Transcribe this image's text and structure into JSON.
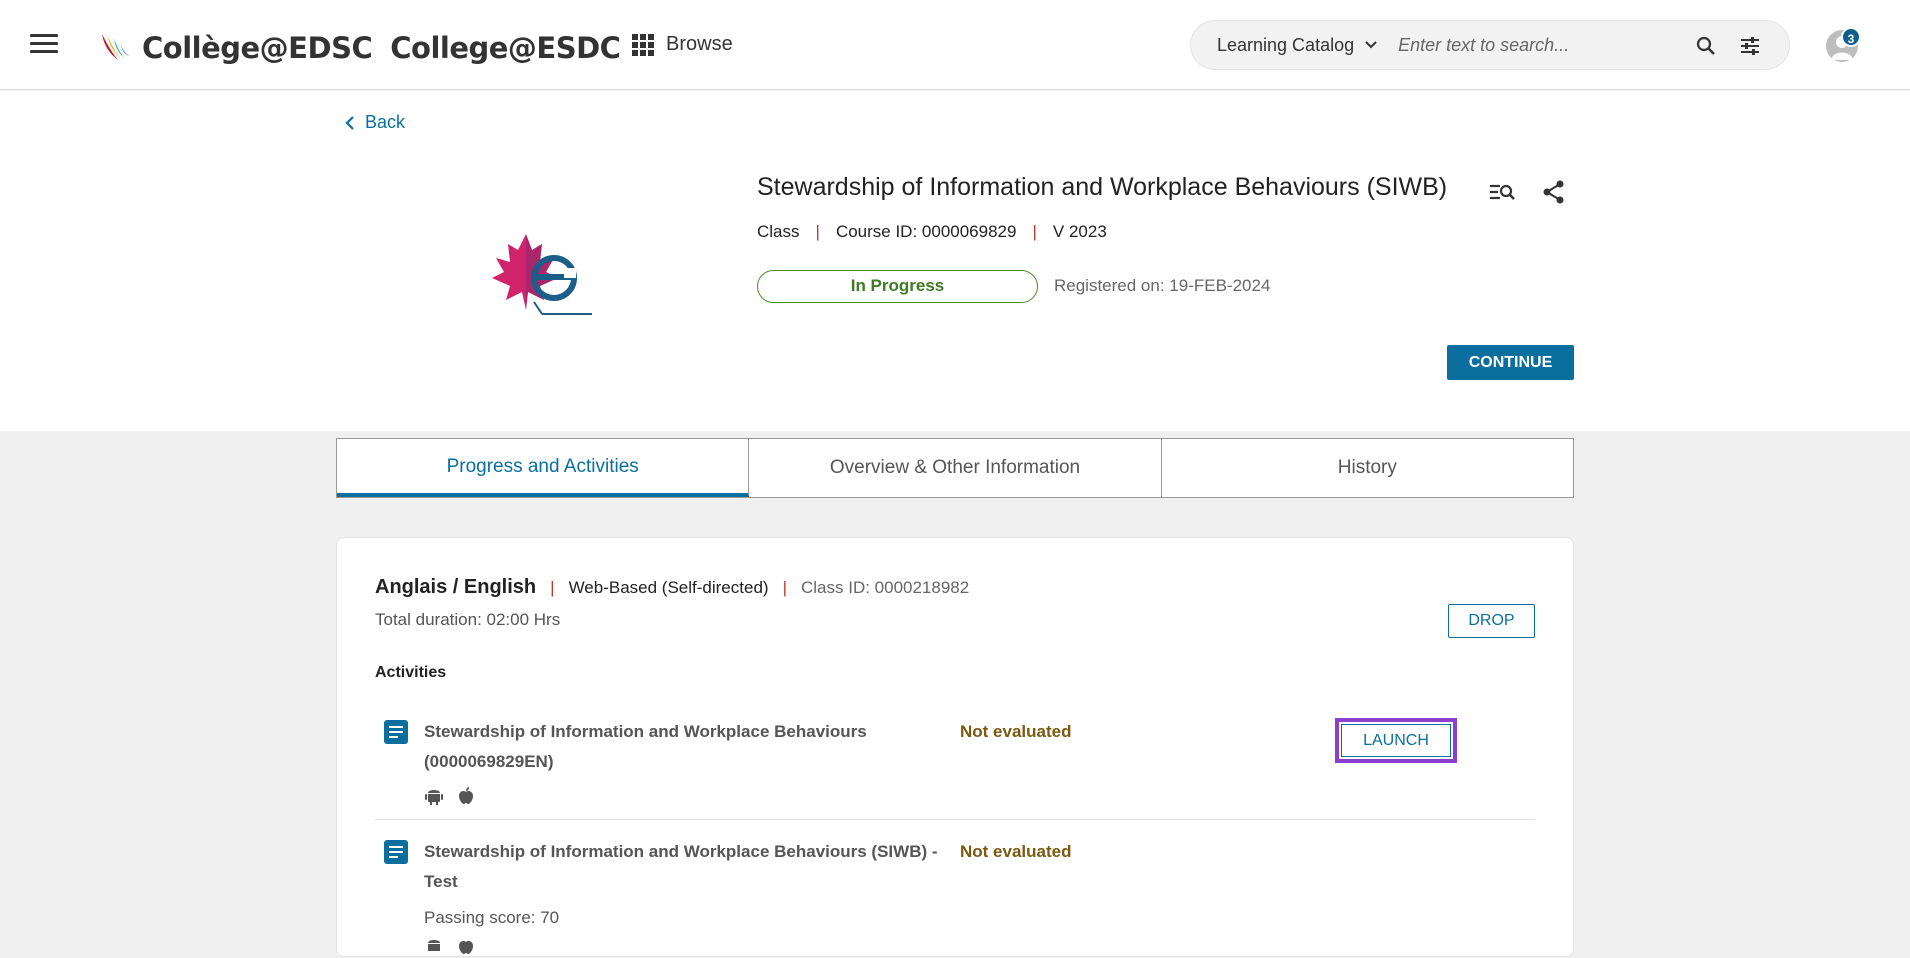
{
  "header": {
    "brand_fr": "Collège@EDSC",
    "brand_en": "College@ESDC",
    "browse_label": "Browse",
    "search": {
      "catalog_label": "Learning Catalog",
      "placeholder": "Enter text to search..."
    },
    "notification_count": "3"
  },
  "course": {
    "back_label": "Back",
    "title": "Stewardship of Information and Workplace Behaviours (SIWB)",
    "type": "Class",
    "course_id": "Course ID: 0000069829",
    "version": "V 2023",
    "status": "In Progress",
    "registered": "Registered on: 19-FEB-2024",
    "continue_label": "CONTINUE"
  },
  "tabs": [
    {
      "label": "Progress and Activities",
      "active": true
    },
    {
      "label": "Overview & Other Information",
      "active": false
    },
    {
      "label": "History",
      "active": false
    }
  ],
  "class_info": {
    "language": "Anglais / English",
    "delivery": "Web-Based (Self-directed)",
    "class_id": "Class ID: 0000218982",
    "duration": "Total duration: 02:00 Hrs",
    "drop_label": "DROP",
    "activities_label": "Activities"
  },
  "activities": [
    {
      "title": "Stewardship of Information and Workplace Behaviours (0000069829EN)",
      "status": "Not evaluated",
      "launch_label": "LAUNCH",
      "platforms": [
        "android-icon",
        "apple-icon"
      ]
    },
    {
      "title": "Stewardship of Information and Workplace Behaviours (SIWB) - Test",
      "status": "Not evaluated",
      "passing_score": "Passing score: 70",
      "platforms": [
        "android-icon",
        "apple-icon"
      ]
    }
  ],
  "colors": {
    "primary": "#0a6f9f",
    "status_green": "#3d7a22",
    "status_not_evaluated": "#7a5a12",
    "highlight": "#8a3fd1",
    "pipe_red": "#c0392b"
  }
}
